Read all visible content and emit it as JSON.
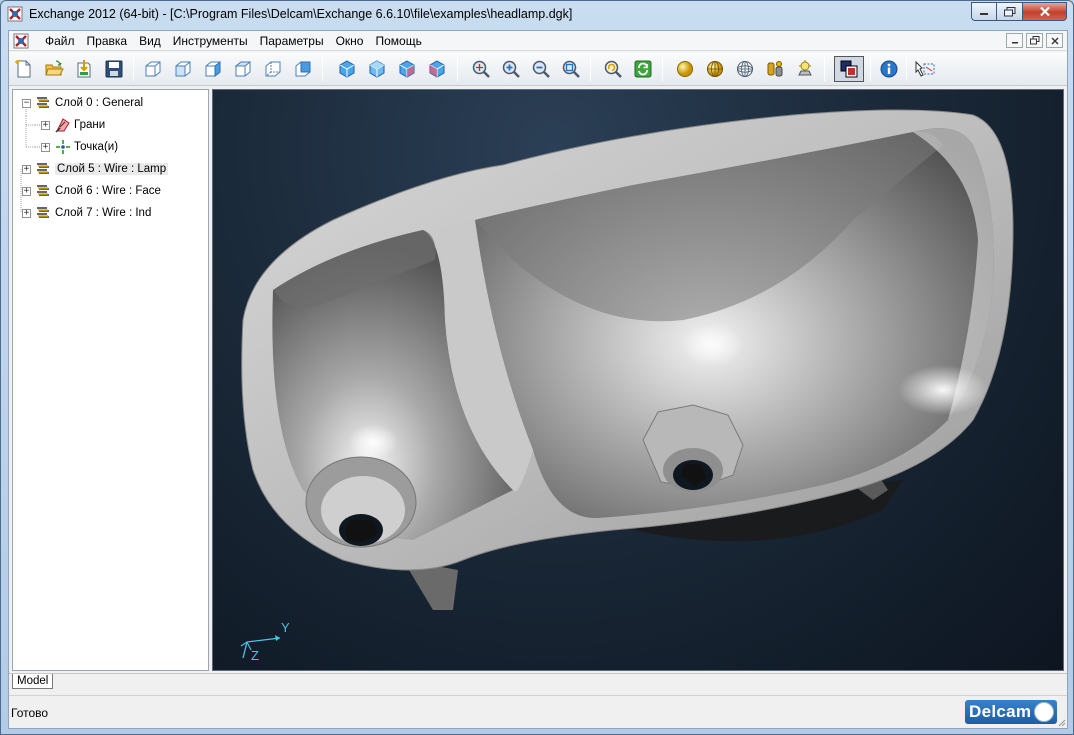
{
  "window": {
    "title": "Exchange 2012 (64-bit) - [C:\\Program Files\\Delcam\\Exchange 6.6.10\\file\\examples\\headlamp.dgk]"
  },
  "menu": {
    "items": [
      {
        "label": "Файл"
      },
      {
        "label": "Правка"
      },
      {
        "label": "Вид"
      },
      {
        "label": "Инструменты"
      },
      {
        "label": "Параметры"
      },
      {
        "label": "Окно"
      },
      {
        "label": "Помощь"
      }
    ]
  },
  "toolbar": {
    "buttons": [
      "new-icon",
      "open-icon",
      "import-icon",
      "save-icon",
      "view-iso-icon",
      "view-front-icon",
      "view-side-icon",
      "view-top-icon",
      "view-back-icon",
      "view-bottom-icon",
      "iso-view-1-icon",
      "iso-view-2-icon",
      "iso-view-3-icon",
      "iso-view-4-icon",
      "zoom-fit-icon",
      "zoom-in-icon",
      "zoom-out-icon",
      "zoom-window-icon",
      "undo-view-icon",
      "refresh-icon",
      "shaded-sphere-icon",
      "shaded-wire-sphere-icon",
      "wireframe-sphere-icon",
      "materials-icon",
      "lights-icon",
      "display-toggle-icon",
      "info-icon",
      "select-icon"
    ]
  },
  "tree": {
    "items": [
      {
        "label": "Слой 0 : General",
        "level": 0,
        "expander": "−"
      },
      {
        "label": "Грани",
        "level": 1,
        "expander": "+"
      },
      {
        "label": "Точка(и)",
        "level": 1,
        "expander": "+"
      },
      {
        "label": "Слой 5 : Wire : Lamp",
        "level": 0,
        "expander": "+"
      },
      {
        "label": "Слой 6 : Wire : Face",
        "level": 0,
        "expander": "+"
      },
      {
        "label": "Слой 7 : Wire : Ind",
        "level": 0,
        "expander": "+"
      }
    ]
  },
  "viewport": {
    "axis_y": "Y",
    "axis_z": "Z"
  },
  "tabs": {
    "model": "Model"
  },
  "status": {
    "text": "Готово",
    "brand": "Delcam"
  },
  "colors": {
    "viewport_bg": "#1b2a3a",
    "axis": "#4fc3e6",
    "brand": "#2a6fba"
  }
}
